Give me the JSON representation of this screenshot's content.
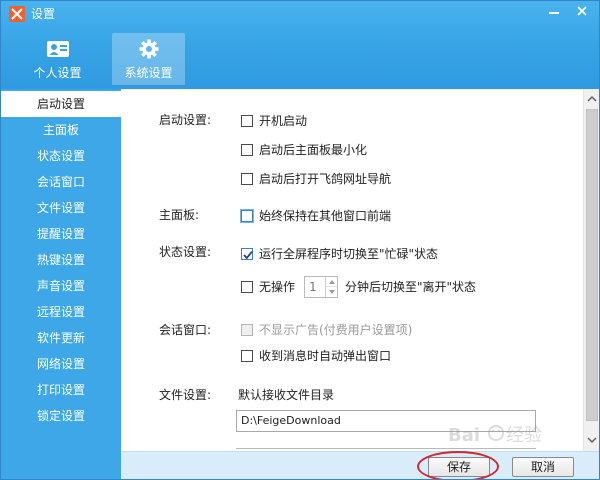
{
  "window": {
    "title": "设置",
    "icon": "feige-app-icon"
  },
  "window_controls": {
    "minimize": "minimize-icon",
    "close": "close-icon"
  },
  "tabs": [
    {
      "label": "个人设置",
      "icon": "profile-card-icon",
      "active": false
    },
    {
      "label": "系统设置",
      "icon": "gear-icon",
      "active": true
    }
  ],
  "sidebar": {
    "items": [
      {
        "label": "启动设置",
        "active": true
      },
      {
        "label": "主面板"
      },
      {
        "label": "状态设置"
      },
      {
        "label": "会话窗口"
      },
      {
        "label": "文件设置"
      },
      {
        "label": "提醒设置"
      },
      {
        "label": "热键设置"
      },
      {
        "label": "声音设置"
      },
      {
        "label": "远程设置"
      },
      {
        "label": "软件更新"
      },
      {
        "label": "网络设置"
      },
      {
        "label": "打印设置"
      },
      {
        "label": "锁定设置"
      }
    ]
  },
  "sections": {
    "startup": {
      "label": "启动设置:",
      "options": [
        {
          "label": "开机启动",
          "checked": false
        },
        {
          "label": "启动后主面板最小化",
          "checked": false
        },
        {
          "label": "启动后打开飞鸽网址导航",
          "checked": false
        }
      ]
    },
    "main_panel": {
      "label": "主面板:",
      "options": [
        {
          "label": "始终保持在其他窗口前端",
          "checked": false
        }
      ]
    },
    "status": {
      "label": "状态设置:",
      "options": [
        {
          "label": "运行全屏程序时切换至\"忙碌\"状态",
          "checked": true
        },
        {
          "label": "无操作",
          "checked": false
        }
      ],
      "idle_minutes": "1",
      "idle_suffix": "分钟后切换至\"离开\"状态"
    },
    "chat_window": {
      "label": "会话窗口:",
      "options": [
        {
          "label": "不显示广告(付费用户设置项)",
          "checked": false,
          "disabled": true
        },
        {
          "label": "收到消息时自动弹出窗口",
          "checked": false
        }
      ]
    },
    "file": {
      "label": "文件设置:",
      "dir_label": "默认接收文件目录",
      "dir_value": "D:\\FeigeDownload"
    }
  },
  "footer": {
    "save_label": "保存",
    "cancel_label": "取消"
  },
  "watermark": "Baidu 经验",
  "colors": {
    "accent": "#3da7e8",
    "header": "#38a5e6",
    "highlight": "#d4262c",
    "footer": "#d9ecfa"
  }
}
